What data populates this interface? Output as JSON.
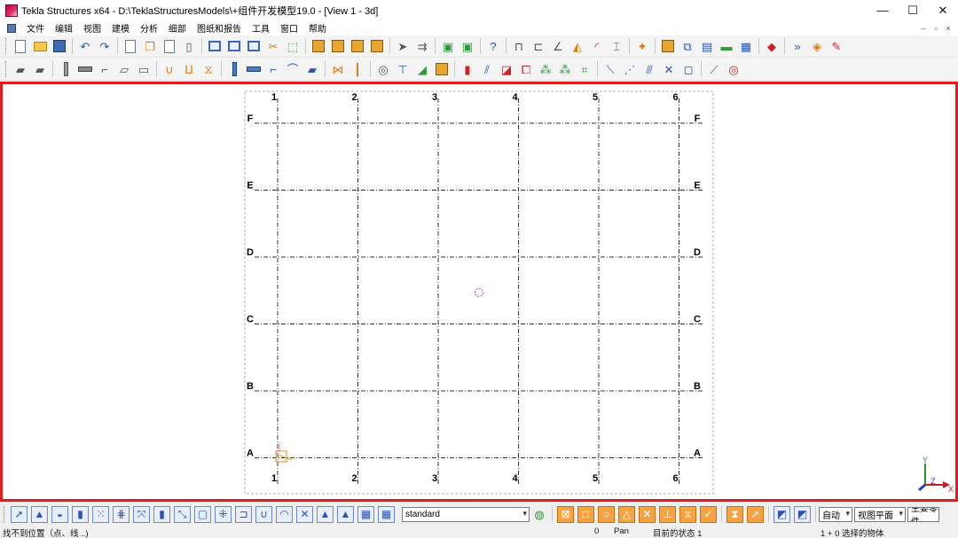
{
  "window": {
    "title": "Tekla Structures x64 - D:\\TeklaStructuresModels\\+组件开发模型19.0  - [View 1 - 3d]",
    "minimize_glyph": "—",
    "maximize_glyph": "☐",
    "close_glyph": "✕"
  },
  "menu": {
    "items": [
      "文件",
      "编辑",
      "视图",
      "建模",
      "分析",
      "细部",
      "图纸和报告",
      "工具",
      "窗口",
      "帮助"
    ],
    "mdi_glyphs": [
      "–",
      "▫",
      "×"
    ]
  },
  "toolbar": {
    "row1_icons": [
      "new-icon",
      "open-icon",
      "save-icon",
      "undo-icon",
      "redo-icon",
      "copy-icon",
      "paste-icon",
      "copy-special-icon",
      "move-icon",
      "window-icon",
      "view-list-icon",
      "view-properties-icon",
      "cut-icon",
      "select-icon",
      "report-icon",
      "drawing-list-icon",
      "drawing-icon",
      "drawing-edit-icon",
      "numbering-icon",
      "clash-icon",
      "assembly-icon",
      "component-icon",
      "help-icon",
      "grid-icon",
      "work-plane-icon",
      "angle-icon",
      "measure-icon",
      "arc-icon",
      "dimension-icon",
      "point-icon",
      "catalog-icon",
      "profile-icon",
      "material-icon",
      "lock-icon",
      "rebar-icon",
      "macro-icon",
      "shortcut-icon",
      "tekla-icon"
    ],
    "row2_icons": [
      "concrete-pad-icon",
      "concrete-strip-icon",
      "concrete-column-icon",
      "concrete-beam-icon",
      "concrete-polybeam-icon",
      "concrete-slab-icon",
      "concrete-panel-icon",
      "bent-plate-icon",
      "loft-plate-icon",
      "item-icon",
      "steel-column-icon",
      "steel-beam-icon",
      "polybeam-icon",
      "curved-beam-icon",
      "orthogonal-beam-icon",
      "twin-profile-icon",
      "contour-plate-icon",
      "bolt-icon",
      "weld-icon",
      "binoculars-icon",
      "inquire-icon",
      "weld-polygon-icon",
      "surface-icon",
      "cut-part-icon",
      "fitting-icon",
      "line-cut-icon",
      "polygon-cut-icon",
      "chamfer-icon",
      "custom-component-icon",
      "detail-icon",
      "point-line-icon",
      "point-on-line-icon",
      "point-extension-icon",
      "point-intersect-icon",
      "point-plane-icon",
      "projection-icon",
      "circle-icon"
    ]
  },
  "viewport": {
    "grid_columns": [
      "1",
      "2",
      "3",
      "4",
      "5",
      "6"
    ],
    "grid_rows": [
      "F",
      "E",
      "D",
      "C",
      "B",
      "A"
    ],
    "axis_labels": [
      "Y",
      "Z",
      "X"
    ],
    "colors": {
      "border": "#e01e1e",
      "grid_line": "#333333",
      "work_area": "#b0b0b0",
      "point_marker": "#d030d0",
      "axis_x": "#c81e1e",
      "axis_y": "#1e9e2e",
      "axis_z": "#1e3ec8"
    }
  },
  "bottombar": {
    "select_icons": [
      "select-all-icon",
      "select-part-icon",
      "select-surface-icon",
      "select-weld-icon",
      "select-cut-icon",
      "select-view-icon",
      "select-load-icon",
      "select-grid-icon",
      "select-gridline-icon",
      "select-point-icon",
      "select-component-icon",
      "select-plane-icon",
      "select-reference-icon",
      "select-bolt-group-icon",
      "select-single-bolt-icon",
      "select-assembly-icon",
      "select-object-icon",
      "select-nested-icon"
    ],
    "filter_value": "standard",
    "snap_icons": [
      "snap-reference-icon",
      "snap-geometry-icon",
      "snap-center-icon",
      "snap-midpoint-icon",
      "snap-intersection-icon",
      "snap-perpendicular-icon",
      "snap-line-extension-icon",
      "snap-any-icon",
      "snap-nearest-icon",
      "snap-free-icon",
      "view-plane-icon",
      "work-plane-icon"
    ],
    "snap_mode": "自动",
    "plane_mode": "视图平面",
    "selection_mode": "主要零件"
  },
  "status": {
    "message": "找不到位置（点、线 ..)",
    "counter": "0",
    "mode": "Pan",
    "current_state": "目前的状态 1",
    "selection": "1 + 0 选择的物体"
  }
}
